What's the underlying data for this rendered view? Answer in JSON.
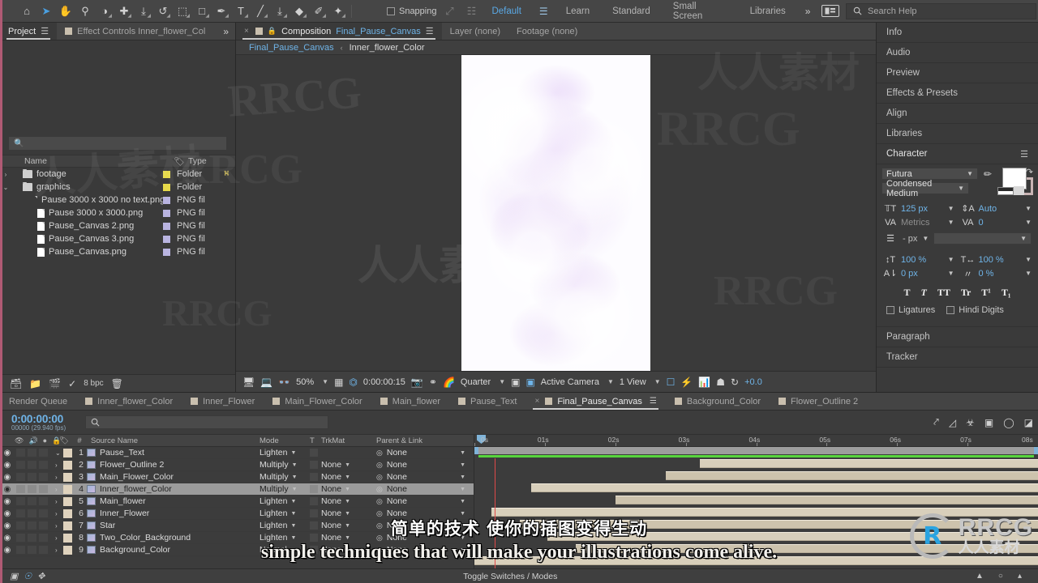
{
  "toolbar": {
    "tools": [
      {
        "name": "home-icon",
        "glyph": "⌂",
        "selected": false
      },
      {
        "name": "selection-tool-icon",
        "glyph": "➤",
        "selected": true
      },
      {
        "name": "hand-tool-icon",
        "glyph": "✋",
        "selected": false
      },
      {
        "name": "zoom-tool-icon",
        "glyph": "⚲",
        "selected": false
      },
      {
        "name": "orbit-tool-icon",
        "glyph": "◑",
        "selected": false
      },
      {
        "name": "pan-tool-icon",
        "glyph": "✚",
        "selected": false
      },
      {
        "name": "dolly-tool-icon",
        "glyph": "⤓",
        "selected": false
      },
      {
        "name": "rotation-tool-icon",
        "glyph": "↺",
        "selected": false
      },
      {
        "name": "region-of-interest-icon",
        "glyph": "⬚",
        "selected": false
      },
      {
        "name": "shape-tool-icon",
        "glyph": "□",
        "selected": false
      },
      {
        "name": "pen-tool-icon",
        "glyph": "✒",
        "selected": false
      },
      {
        "name": "type-tool-icon",
        "glyph": "T",
        "selected": false
      },
      {
        "name": "brush-tool-icon",
        "glyph": "╱",
        "selected": false
      },
      {
        "name": "clone-stamp-tool-icon",
        "glyph": "⤓",
        "selected": false
      },
      {
        "name": "eraser-tool-icon",
        "glyph": "◆",
        "selected": false
      },
      {
        "name": "roto-brush-tool-icon",
        "glyph": "✐",
        "selected": false
      },
      {
        "name": "puppet-pin-tool-icon",
        "glyph": "✦",
        "selected": false
      }
    ],
    "snapping_label": "Snapping",
    "workspaces": [
      {
        "label": "Default",
        "active": true
      },
      {
        "label": "Learn",
        "active": false
      },
      {
        "label": "Standard",
        "active": false
      },
      {
        "label": "Small Screen",
        "active": false
      },
      {
        "label": "Libraries",
        "active": false
      }
    ],
    "more_chevron": "»",
    "search_placeholder": "Search Help"
  },
  "project": {
    "tabs": [
      {
        "label": "Project",
        "active": true,
        "has_menu": true
      },
      {
        "label": "Effect Controls Inner_flower_Col",
        "active": false,
        "has_menu": false
      }
    ],
    "more": "»",
    "search_placeholder": "",
    "columns": [
      "Name",
      "Type"
    ],
    "items": [
      {
        "name": "footage",
        "type": "Folder",
        "kind": "folder",
        "indent": 0,
        "twirl": "›",
        "shared": true
      },
      {
        "name": "graphics",
        "type": "Folder",
        "kind": "folder",
        "indent": 0,
        "twirl": "⌄",
        "shared": false
      },
      {
        "name": "Pause 3000 x 3000 no text.png",
        "type": "PNG fil",
        "kind": "file",
        "indent": 1,
        "twirl": "",
        "shared": false
      },
      {
        "name": "Pause 3000 x 3000.png",
        "type": "PNG fil",
        "kind": "file",
        "indent": 1,
        "twirl": "",
        "shared": false
      },
      {
        "name": "Pause_Canvas 2.png",
        "type": "PNG fil",
        "kind": "file",
        "indent": 1,
        "twirl": "",
        "shared": false
      },
      {
        "name": "Pause_Canvas 3.png",
        "type": "PNG fil",
        "kind": "file",
        "indent": 1,
        "twirl": "",
        "shared": false
      },
      {
        "name": "Pause_Canvas.png",
        "type": "PNG fil",
        "kind": "file",
        "indent": 1,
        "twirl": "",
        "shared": false
      }
    ],
    "footer": {
      "bpc": "8 bpc"
    }
  },
  "composition": {
    "tabs": [
      {
        "label_prefix": "Composition",
        "label": "Final_Pause_Canvas",
        "active": true
      },
      {
        "label": "Layer (none)",
        "active": false
      },
      {
        "label": "Footage (none)",
        "active": false
      }
    ],
    "breadcrumb": {
      "current": "Final_Pause_Canvas",
      "sep": "‹",
      "next": "Inner_flower_Color"
    },
    "footer": {
      "zoom": "50%",
      "timecode": "0:00:00:15",
      "resolution": "Quarter",
      "camera": "Active Camera",
      "views": "1 View",
      "exposure": "+0.0"
    }
  },
  "right_panel": {
    "sections": [
      "Info",
      "Audio",
      "Preview",
      "Effects & Presets",
      "Align",
      "Libraries"
    ],
    "character": {
      "title": "Character",
      "font_family": "Futura",
      "font_style": "Condensed Medium",
      "font_size": "125 px",
      "leading": "Auto",
      "kerning": "Metrics",
      "tracking": "0",
      "stroke_width": "- px",
      "vertical_scale": "100 %",
      "horizontal_scale": "100 %",
      "baseline_shift": "0 px",
      "tsume": "0 %",
      "style_buttons": [
        "T",
        "T",
        "TT",
        "Tr",
        "T¹",
        "T₁"
      ],
      "ligatures_label": "Ligatures",
      "hindi_label": "Hindi Digits"
    },
    "paragraph": "Paragraph",
    "tracker": "Tracker"
  },
  "timeline": {
    "tabs": [
      {
        "label": "Render Queue",
        "active": false,
        "swatch": false
      },
      {
        "label": "Inner_flower_Color",
        "active": false,
        "swatch": true
      },
      {
        "label": "Inner_Flower",
        "active": false,
        "swatch": true
      },
      {
        "label": "Main_Flower_Color",
        "active": false,
        "swatch": true
      },
      {
        "label": "Main_flower",
        "active": false,
        "swatch": true
      },
      {
        "label": "Pause_Text",
        "active": false,
        "swatch": true
      },
      {
        "label": "Final_Pause_Canvas",
        "active": true,
        "swatch": true
      },
      {
        "label": "Background_Color",
        "active": false,
        "swatch": true
      },
      {
        "label": "Flower_Outline 2",
        "active": false,
        "swatch": true
      }
    ],
    "current_time": "0:00:00:00",
    "frame_info": "00000 (29.940 fps)",
    "search_placeholder": "",
    "columns": [
      "Source Name",
      "Mode",
      "T",
      "TrkMat",
      "Parent & Link"
    ],
    "layers": [
      {
        "num": "1",
        "name": "Pause_Text",
        "mode": "Lighten",
        "trkmat": "",
        "parent": "None",
        "twirl": "⌄",
        "selected": false,
        "bar_start": 40,
        "bar_end": 100
      },
      {
        "num": "2",
        "name": "Flower_Outline 2",
        "mode": "Multiply",
        "trkmat": "None",
        "parent": "None",
        "twirl": "›",
        "selected": false,
        "bar_start": 34,
        "bar_end": 100
      },
      {
        "num": "3",
        "name": "Main_Flower_Color",
        "mode": "Multiply",
        "trkmat": "None",
        "parent": "None",
        "twirl": "›",
        "selected": false,
        "bar_start": 10,
        "bar_end": 100
      },
      {
        "num": "4",
        "name": "Inner_flower_Color",
        "mode": "Multiply",
        "trkmat": "None",
        "parent": "None",
        "twirl": "›",
        "selected": true,
        "bar_start": 25,
        "bar_end": 100
      },
      {
        "num": "5",
        "name": "Main_flower",
        "mode": "Lighten",
        "trkmat": "None",
        "parent": "None",
        "twirl": "›",
        "selected": false,
        "bar_start": 3,
        "bar_end": 100
      },
      {
        "num": "6",
        "name": "Inner_Flower",
        "mode": "Lighten",
        "trkmat": "None",
        "parent": "None",
        "twirl": "›",
        "selected": false,
        "bar_start": 8,
        "bar_end": 100
      },
      {
        "num": "7",
        "name": "Star",
        "mode": "Lighten",
        "trkmat": "None",
        "parent": "None",
        "twirl": "›",
        "selected": false,
        "bar_start": 13,
        "bar_end": 100
      },
      {
        "num": "8",
        "name": "Two_Color_Background",
        "mode": "Lighten",
        "trkmat": "None",
        "parent": "None",
        "twirl": "›",
        "selected": false,
        "bar_start": 18,
        "bar_end": 100
      },
      {
        "num": "9",
        "name": "Background_Color",
        "mode": "Normal",
        "trkmat": "None",
        "parent": "None",
        "twirl": "›",
        "selected": false,
        "bar_start": 0,
        "bar_end": 100
      }
    ],
    "ruler_ticks": [
      "0s",
      "01s",
      "02s",
      "03s",
      "04s",
      "05s",
      "06s",
      "07s",
      "08s"
    ],
    "footer_label": "Toggle Switches / Modes"
  },
  "subtitles": {
    "chinese": "简单的技术 使你的插图变得生动",
    "english": "simple techniques that will make your illustrations come alive."
  },
  "logo": {
    "mark": "R",
    "name": "RRCG",
    "subtitle": "人人素材"
  },
  "watermarks": {
    "latin": "RRCG",
    "cjk": "人人素材"
  },
  "colors": {
    "accent_blue": "#6fb4e8",
    "panel_bg": "#3a3a3a",
    "toolbar_bg": "#464646",
    "layer_bar": "#d8cfbb",
    "render_green": "#57d53d",
    "cti_red": "#e04a4a"
  }
}
